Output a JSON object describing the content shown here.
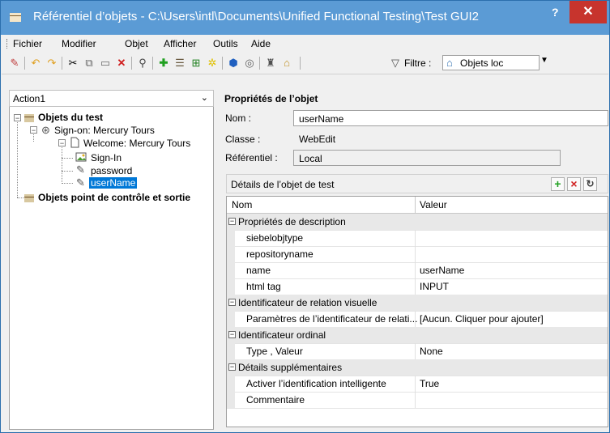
{
  "window": {
    "title": "Référentiel d’objets - C:\\Users\\intl\\Documents\\Unified Functional Testing\\Test GUI2",
    "help": "?",
    "close": "✕"
  },
  "menu": [
    "Fichier",
    "Modifier",
    "Objet",
    "Afficher",
    "Outils",
    "Aide"
  ],
  "toolbar": {
    "filter_label": "Filtre :",
    "filter_value": "Objets loc"
  },
  "left": {
    "action": "Action1",
    "tree": {
      "root": "Objets du test",
      "page1": "Sign-on: Mercury Tours",
      "page2": "Welcome: Mercury Tours",
      "item1": "Sign-In",
      "item2": "password",
      "item3": "userName",
      "root2": "Objets point de contrôle et sortie"
    }
  },
  "props": {
    "title": "Propriétés de l’objet",
    "name_label": "Nom :",
    "name_value": "userName",
    "class_label": "Classe :",
    "class_value": "WebEdit",
    "repo_label": "Référentiel :",
    "repo_value": "Local",
    "details_title": "Détails de l’objet de test"
  },
  "grid": {
    "col_name": "Nom",
    "col_value": "Valeur",
    "rows": [
      {
        "name": "Propriétés de description",
        "value": "",
        "cat": true
      },
      {
        "name": "siebelobjtype",
        "value": ""
      },
      {
        "name": "repositoryname",
        "value": ""
      },
      {
        "name": "name",
        "value": "userName"
      },
      {
        "name": "html tag",
        "value": "INPUT"
      },
      {
        "name": "Identificateur de relation visuelle",
        "value": "",
        "cat": true
      },
      {
        "name": "Paramètres de l’identificateur de relati...",
        "value": "[Aucun. Cliquer pour ajouter]"
      },
      {
        "name": "Identificateur ordinal",
        "value": "",
        "cat": true
      },
      {
        "name": "Type , Valeur",
        "value": "None"
      },
      {
        "name": "Détails supplémentaires",
        "value": "",
        "cat": true
      },
      {
        "name": "Activer l’identification intelligente",
        "value": "True"
      },
      {
        "name": "Commentaire",
        "value": ""
      }
    ]
  }
}
